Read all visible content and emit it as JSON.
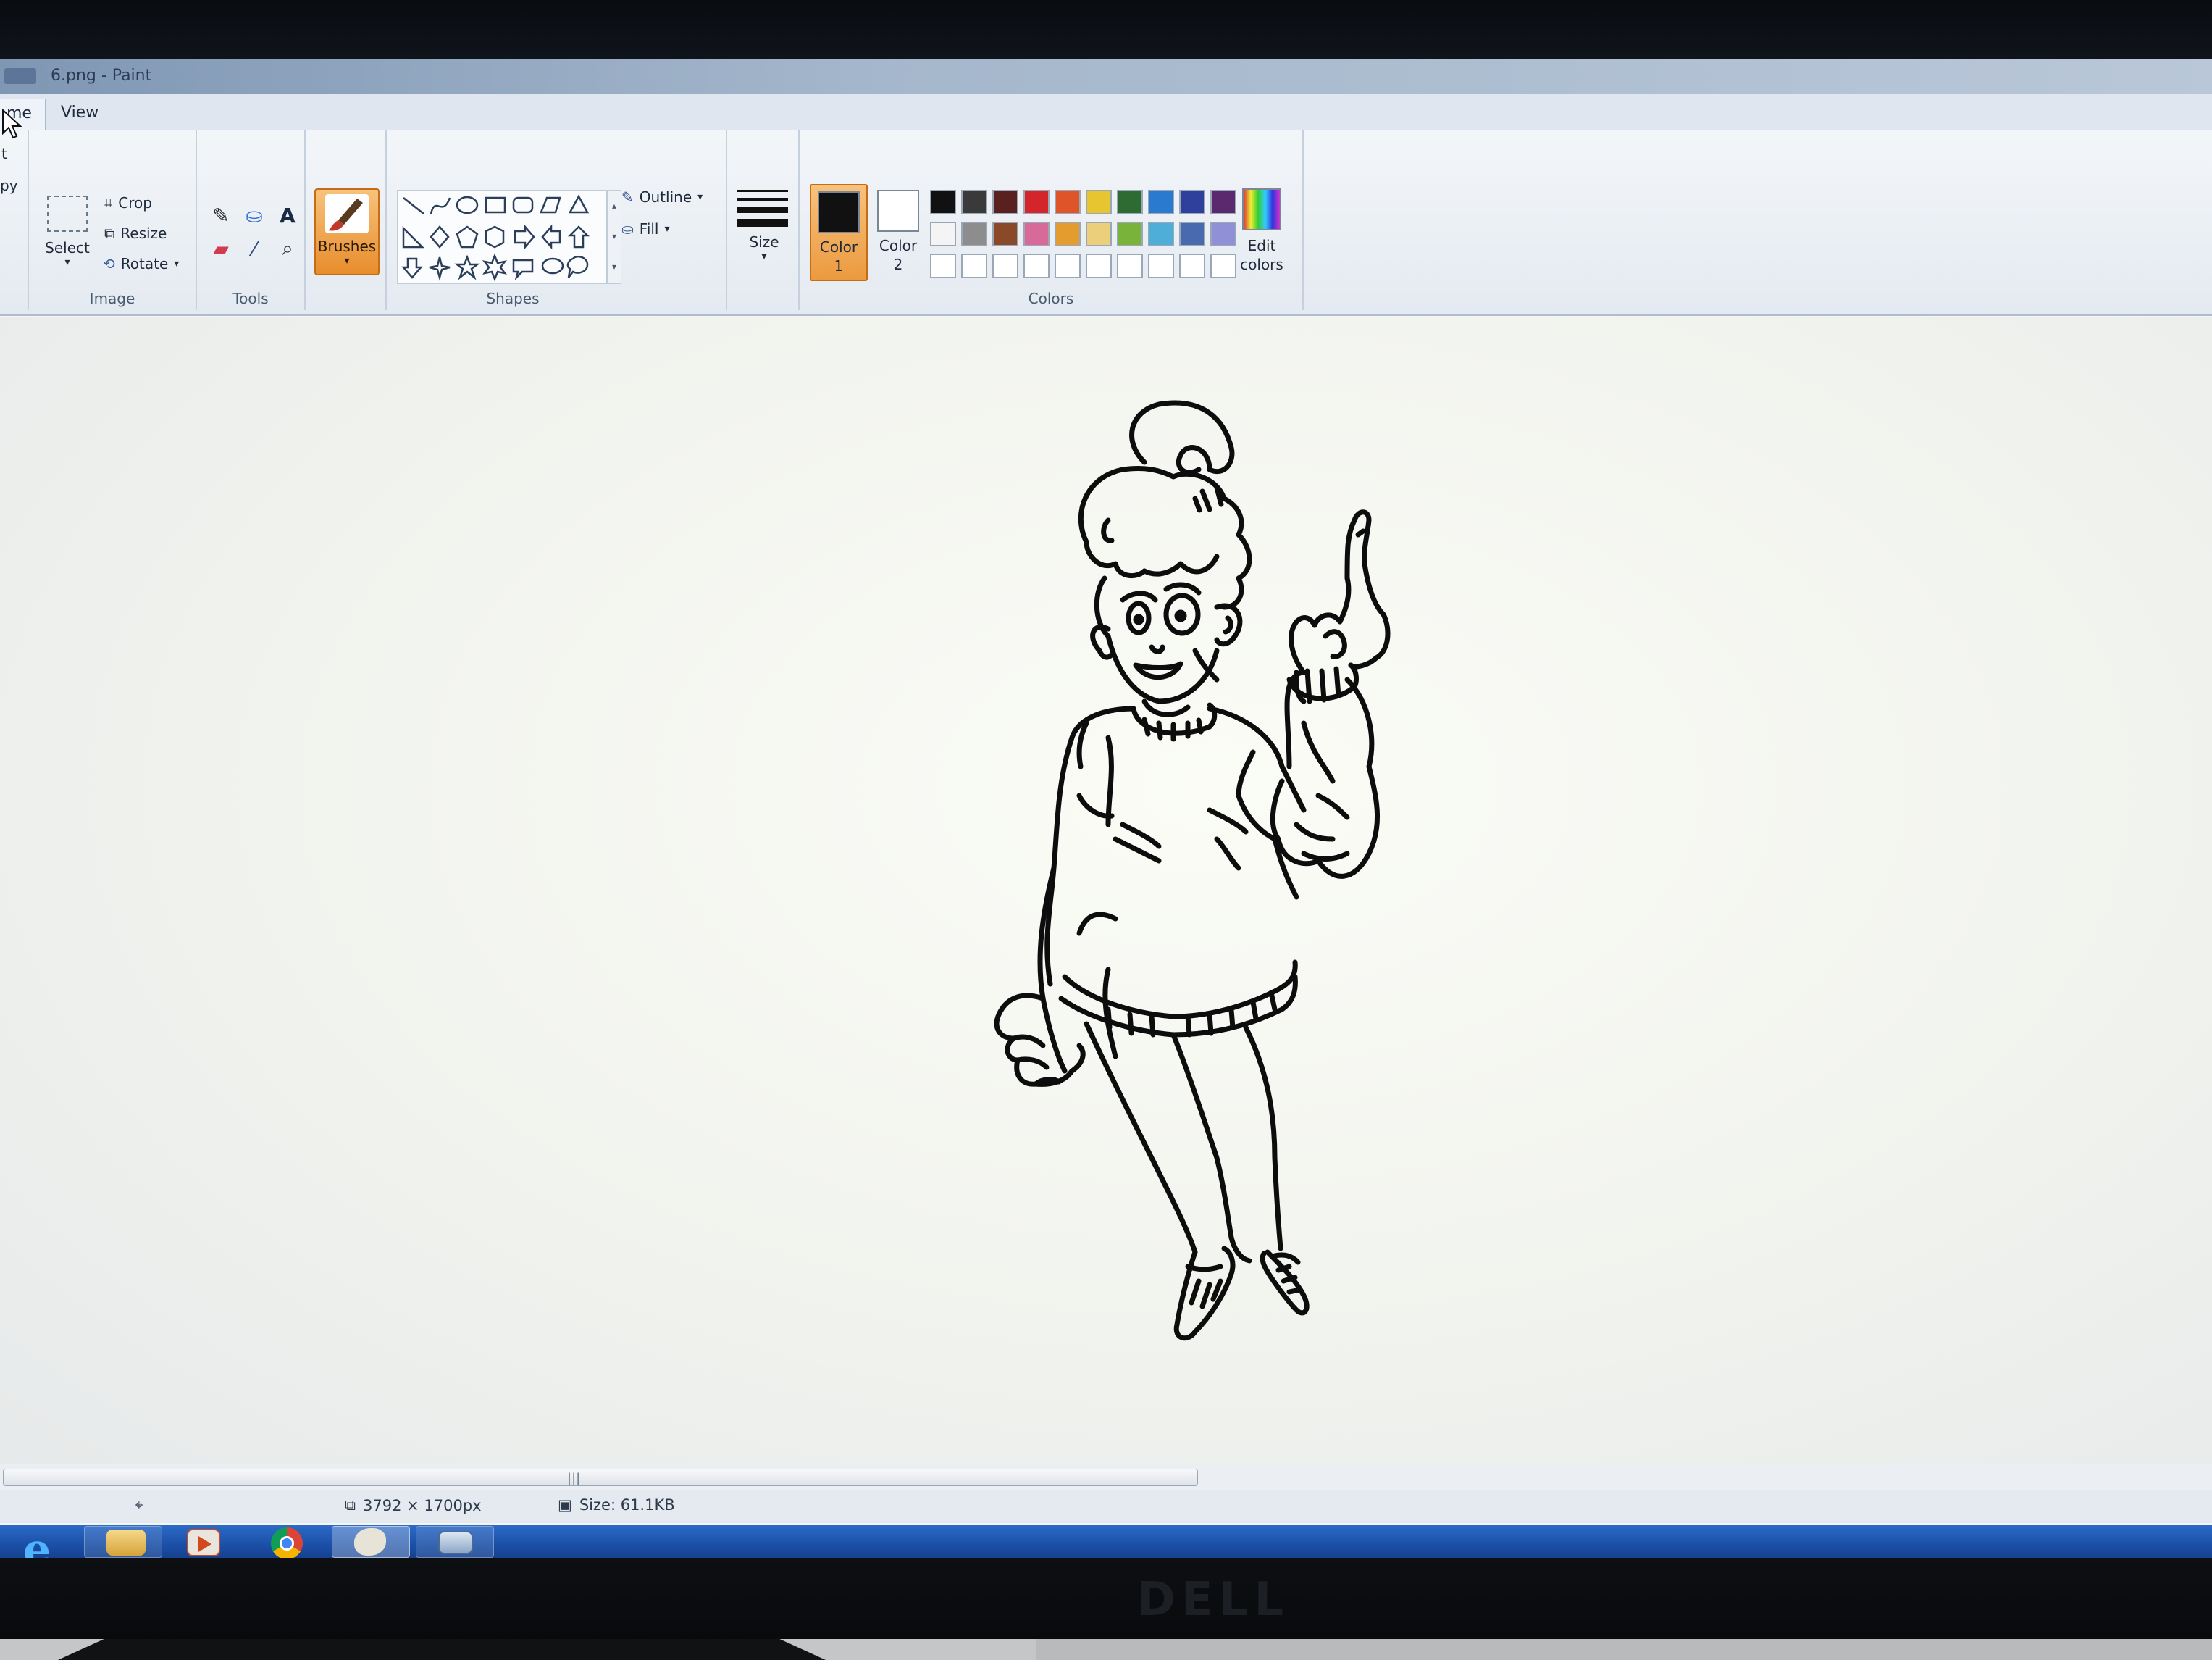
{
  "window": {
    "title": "6.png - Paint"
  },
  "tabs": {
    "home": "me",
    "view": "View"
  },
  "ribbon": {
    "clipboard_fragments": [
      "t",
      "py"
    ],
    "image": {
      "label": "Image",
      "select": "Select",
      "crop": "Crop",
      "resize": "Resize",
      "rotate": "Rotate"
    },
    "tools": {
      "label": "Tools"
    },
    "brushes": "Brushes",
    "shapes": {
      "label": "Shapes",
      "outline": "Outline",
      "fill": "Fill"
    },
    "size": "Size",
    "colors": {
      "label": "Colors",
      "color1": {
        "label": "Color",
        "num": "1",
        "value": "#111111"
      },
      "color2": {
        "label": "Color",
        "num": "2",
        "value": "#ffffff"
      },
      "edit": "Edit",
      "edit2": "colors",
      "palette_row1": [
        "#111111",
        "#3a3a3a",
        "#5a1f1f",
        "#d4262a",
        "#e0542a",
        "#e7c531",
        "#2e6b32",
        "#2a7ad0",
        "#2f3f9c",
        "#5b2a6e"
      ],
      "palette_row2": [
        "#f4f4f4",
        "#8d8d8d",
        "#8a4a2a",
        "#d86a9a",
        "#e59c2e",
        "#eccf7a",
        "#7ab33a",
        "#4eaed8",
        "#4a6ab0",
        "#8f90d6"
      ],
      "palette_row3": [
        "#ffffff",
        "#ffffff",
        "#ffffff",
        "#ffffff",
        "#ffffff",
        "#ffffff",
        "#ffffff",
        "#ffffff",
        "#ffffff",
        "#ffffff"
      ]
    }
  },
  "status": {
    "dimensions": "3792 × 1700px",
    "size": "Size: 61.1KB"
  },
  "taskbar": {
    "apps": [
      "internet-explorer",
      "file-explorer",
      "media-player",
      "chrome",
      "paint",
      "other-window"
    ]
  },
  "monitor": {
    "brand": "DELL"
  }
}
